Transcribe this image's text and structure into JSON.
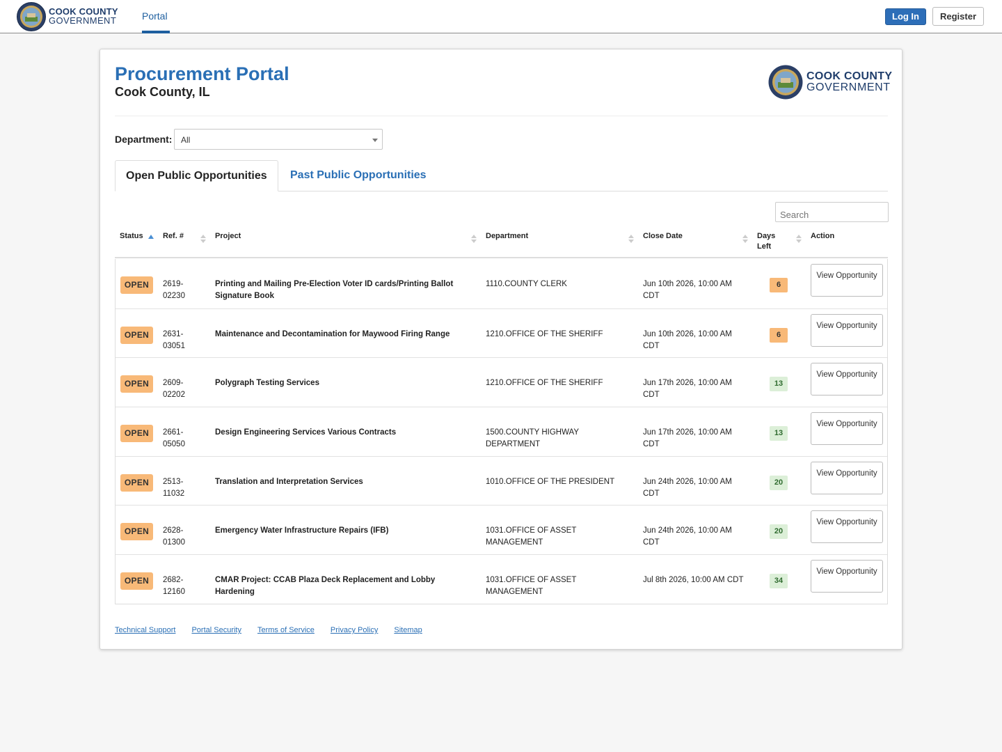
{
  "nav": {
    "brand_line1": "COOK COUNTY",
    "brand_line2": "GOVERNMENT",
    "tab_portal": "Portal",
    "login": "Log In",
    "register": "Register"
  },
  "header": {
    "title": "Procurement Portal",
    "subtitle": "Cook County, IL",
    "brand_line1": "COOK COUNTY",
    "brand_line2": "GOVERNMENT"
  },
  "filters": {
    "department_label": "Department:",
    "department_value": "All"
  },
  "tabs": {
    "open": "Open Public Opportunities",
    "past": "Past Public Opportunities"
  },
  "search": {
    "placeholder": "Search"
  },
  "table": {
    "columns": {
      "status": "Status",
      "ref": "Ref. #",
      "project": "Project",
      "department": "Department",
      "close_date": "Close Date",
      "days_left": "Days Left",
      "action": "Action"
    },
    "rows": [
      {
        "status": "OPEN",
        "ref": "2619-02230",
        "project": "Printing and Mailing Pre-Election Voter ID cards/Printing Ballot Signature Book",
        "department": "1110.COUNTY CLERK",
        "close": "Jun 10th 2026, 10:00 AM CDT",
        "days": "6",
        "days_level": "warn",
        "action": "View Opportunity"
      },
      {
        "status": "OPEN",
        "ref": "2631-03051",
        "project": "Maintenance and Decontamination for Maywood Firing Range",
        "department": "1210.OFFICE OF THE SHERIFF",
        "close": "Jun 10th 2026, 10:00 AM CDT",
        "days": "6",
        "days_level": "warn",
        "action": "View Opportunity"
      },
      {
        "status": "OPEN",
        "ref": "2609-02202",
        "project": "Polygraph Testing Services",
        "department": "1210.OFFICE OF THE SHERIFF",
        "close": "Jun 17th 2026, 10:00 AM CDT",
        "days": "13",
        "days_level": "ok",
        "action": "View Opportunity"
      },
      {
        "status": "OPEN",
        "ref": "2661-05050",
        "project": "Design Engineering Services Various Contracts",
        "department": "1500.COUNTY HIGHWAY DEPARTMENT",
        "close": "Jun 17th 2026, 10:00 AM CDT",
        "days": "13",
        "days_level": "ok",
        "action": "View Opportunity"
      },
      {
        "status": "OPEN",
        "ref": "2513-11032",
        "project": "Translation and Interpretation Services",
        "department": "1010.OFFICE OF THE PRESIDENT",
        "close": "Jun 24th 2026, 10:00 AM CDT",
        "days": "20",
        "days_level": "ok",
        "action": "View Opportunity"
      },
      {
        "status": "OPEN",
        "ref": "2628-01300",
        "project": "Emergency Water Infrastructure Repairs (IFB)",
        "department": "1031.OFFICE OF ASSET MANAGEMENT",
        "close": "Jun 24th 2026, 10:00 AM CDT",
        "days": "20",
        "days_level": "ok",
        "action": "View Opportunity"
      },
      {
        "status": "OPEN",
        "ref": "2682-12160",
        "project": "CMAR Project: CCAB Plaza Deck Replacement and Lobby Hardening",
        "department": "1031.OFFICE OF ASSET MANAGEMENT",
        "close": "Jul 8th 2026, 10:00 AM CDT",
        "days": "34",
        "days_level": "ok",
        "action": "View Opportunity"
      }
    ]
  },
  "footer": {
    "links": [
      "Technical Support",
      "Portal Security",
      "Terms of Service",
      "Privacy Policy",
      "Sitemap"
    ]
  },
  "colors": {
    "accent": "#2a6fb5",
    "status_open": "#f8b978",
    "days_ok": "#dcefd8"
  }
}
